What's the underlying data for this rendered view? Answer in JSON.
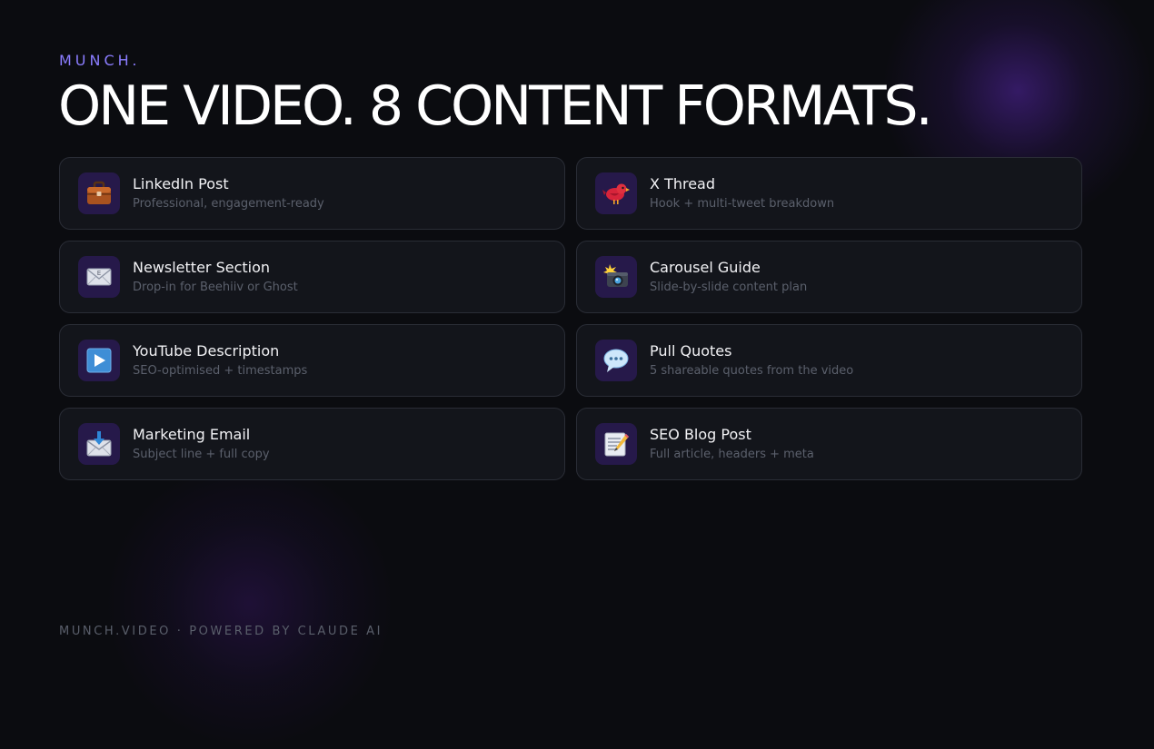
{
  "brand": "MUNCH.",
  "headline": "ONE VIDEO. 8 CONTENT FORMATS.",
  "formats": [
    {
      "title": "LinkedIn Post",
      "subtitle": "Professional, engagement-ready",
      "icon": "briefcase-icon"
    },
    {
      "title": "X Thread",
      "subtitle": "Hook + multi-tweet breakdown",
      "icon": "bird-icon"
    },
    {
      "title": "Newsletter Section",
      "subtitle": "Drop-in for Beehiiv or Ghost",
      "icon": "envelope-icon"
    },
    {
      "title": "Carousel Guide",
      "subtitle": "Slide-by-slide content plan",
      "icon": "camera-flash-icon"
    },
    {
      "title": "YouTube Description",
      "subtitle": "SEO-optimised + timestamps",
      "icon": "play-button-icon"
    },
    {
      "title": "Pull Quotes",
      "subtitle": "5 shareable quotes from the video",
      "icon": "speech-bubble-icon"
    },
    {
      "title": "Marketing Email",
      "subtitle": "Subject line + full copy",
      "icon": "incoming-envelope-icon"
    },
    {
      "title": "SEO Blog Post",
      "subtitle": "Full article, headers + meta",
      "icon": "memo-icon"
    }
  ],
  "footer": "MUNCH.VIDEO · POWERED BY CLAUDE AI",
  "colors": {
    "background": "#0b0c10",
    "accent": "#8b7dff",
    "card": "#13151b",
    "card_border": "#2a2d36",
    "icon_tile": "#26194a",
    "muted_text": "#5b606c"
  }
}
